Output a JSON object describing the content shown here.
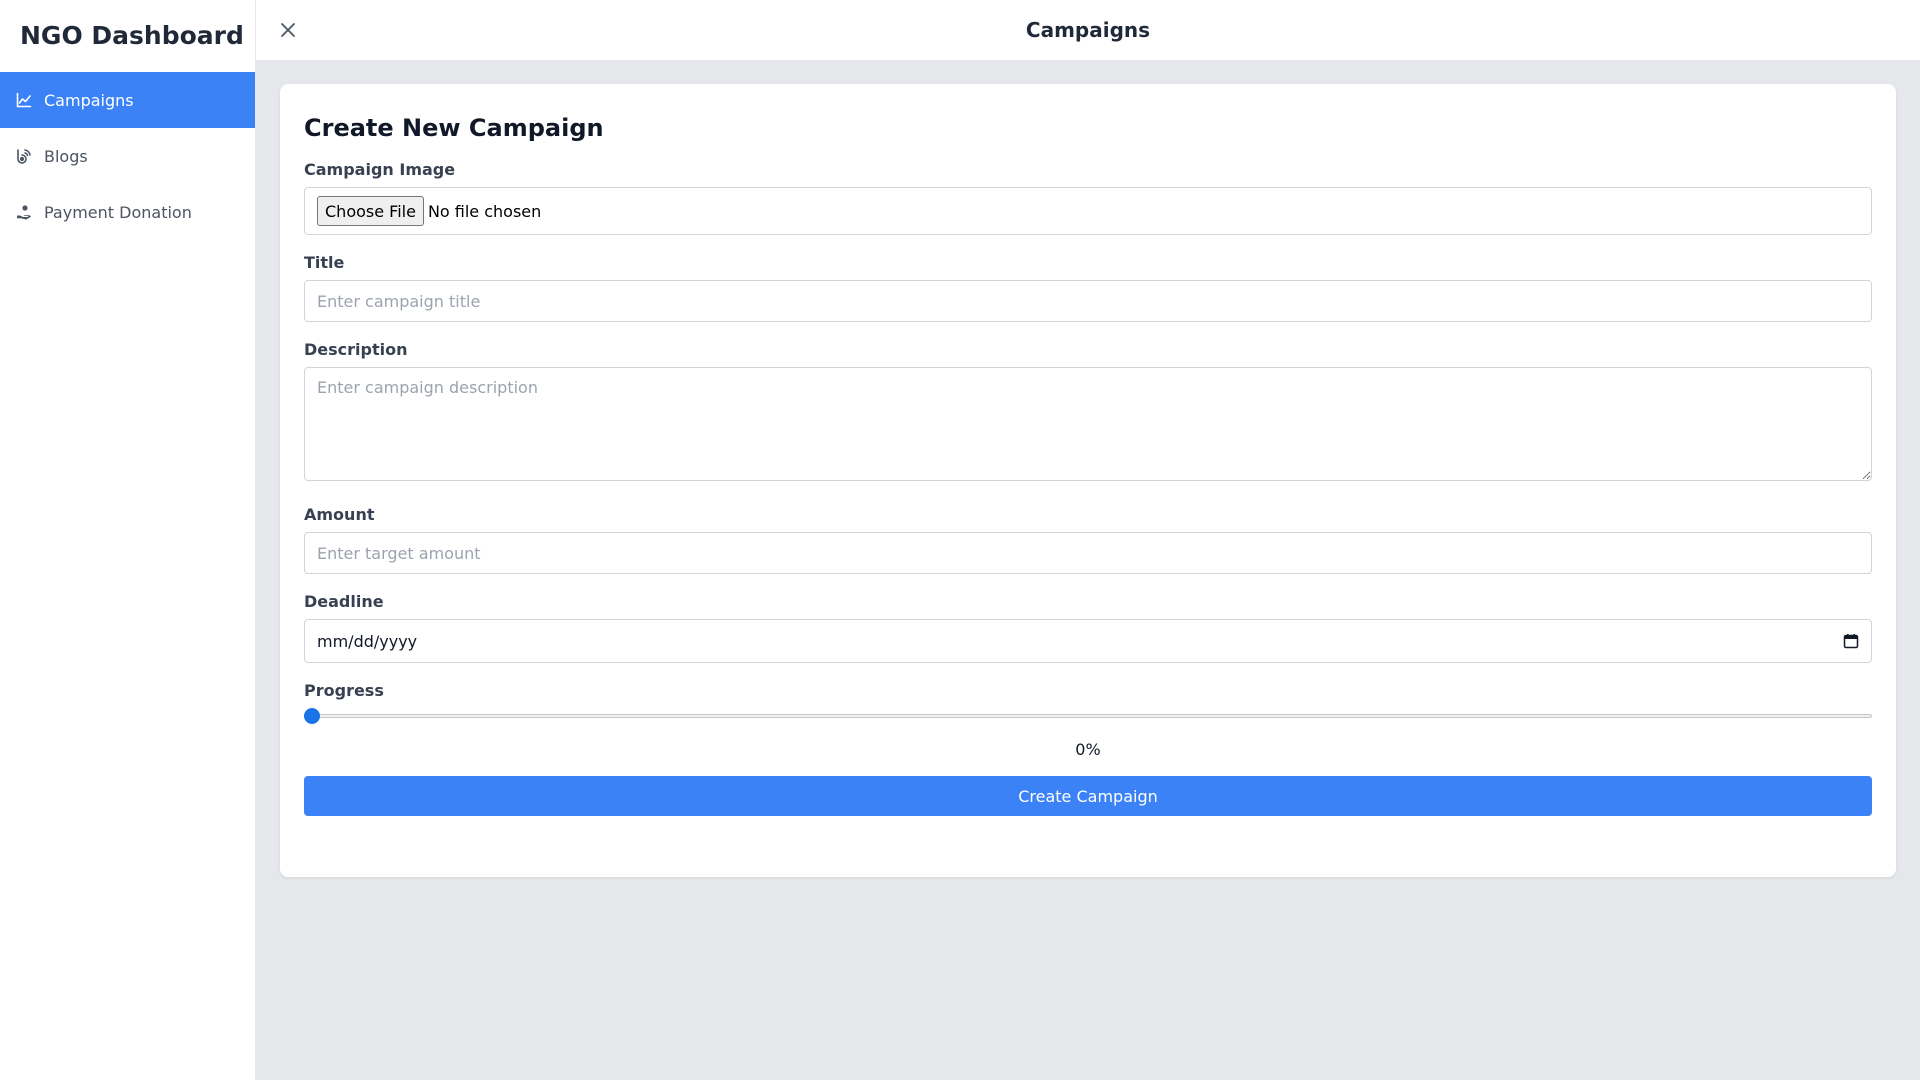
{
  "sidebar": {
    "brand": "NGO Dashboard",
    "items": [
      {
        "label": "Campaigns",
        "icon": "chart-line-icon",
        "active": true
      },
      {
        "label": "Blogs",
        "icon": "blog-icon",
        "active": false
      },
      {
        "label": "Payment Donation",
        "icon": "hand-donation-icon",
        "active": false
      }
    ]
  },
  "header": {
    "title": "Campaigns",
    "close_icon": "close-icon"
  },
  "form": {
    "title": "Create New Campaign",
    "image": {
      "label": "Campaign Image",
      "button": "Choose File",
      "status": "No file chosen"
    },
    "title_field": {
      "label": "Title",
      "placeholder": "Enter campaign title",
      "value": ""
    },
    "description": {
      "label": "Description",
      "placeholder": "Enter campaign description",
      "value": ""
    },
    "amount": {
      "label": "Amount",
      "placeholder": "Enter target amount",
      "value": ""
    },
    "deadline": {
      "label": "Deadline",
      "value": "mm/dd/yyyy",
      "icon": "calendar-icon"
    },
    "progress": {
      "label": "Progress",
      "value": 0,
      "display": "0%"
    },
    "submit_label": "Create Campaign"
  },
  "colors": {
    "accent": "#3b82f6",
    "background": "#e5e7eb",
    "surface": "#ffffff"
  }
}
